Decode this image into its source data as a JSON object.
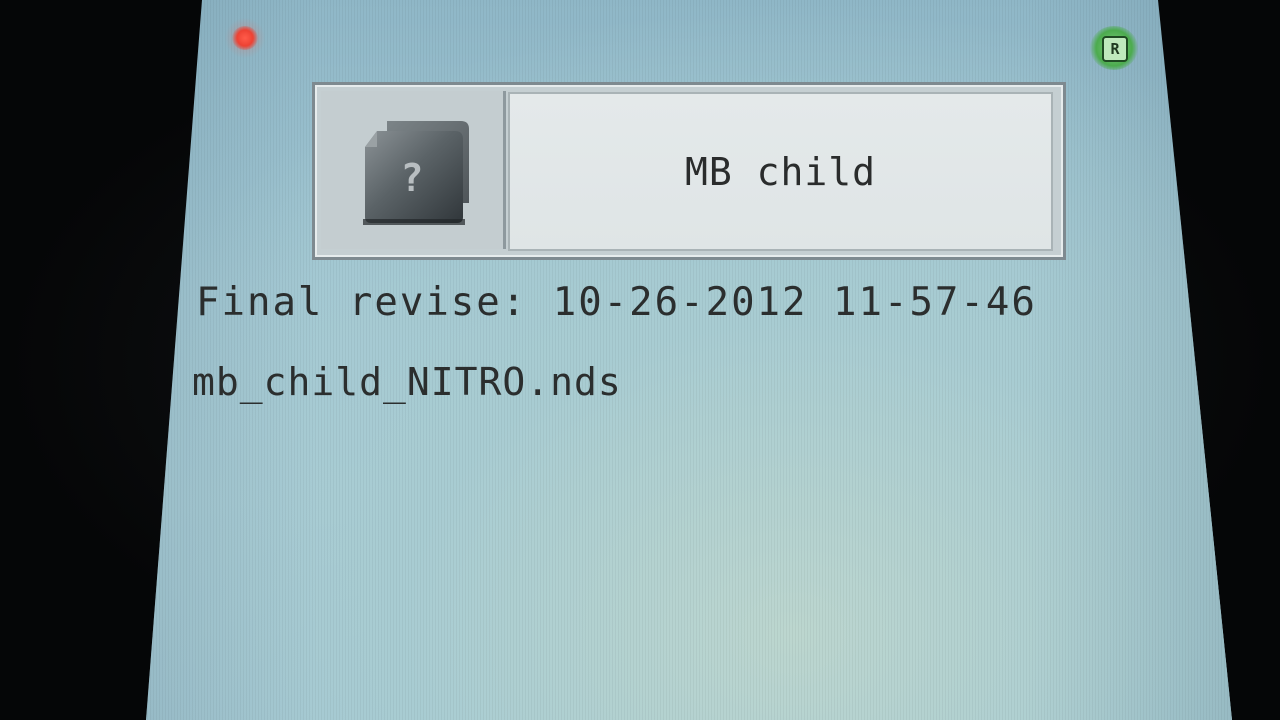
{
  "header": {
    "status_light_color": "#e83b2e",
    "r_badge_label": "R",
    "r_badge_color": "#4cab4e"
  },
  "title_box": {
    "icon": "unknown-card-question-icon",
    "icon_glyph": "?",
    "name": "MB child"
  },
  "info": {
    "final_revise": "Final revise: 10-26-2012 11-57-46",
    "filename": "mb_child_NITRO.nds"
  },
  "colors": {
    "screen_background": "#a2c7d3",
    "text": "#2b2e2e"
  }
}
